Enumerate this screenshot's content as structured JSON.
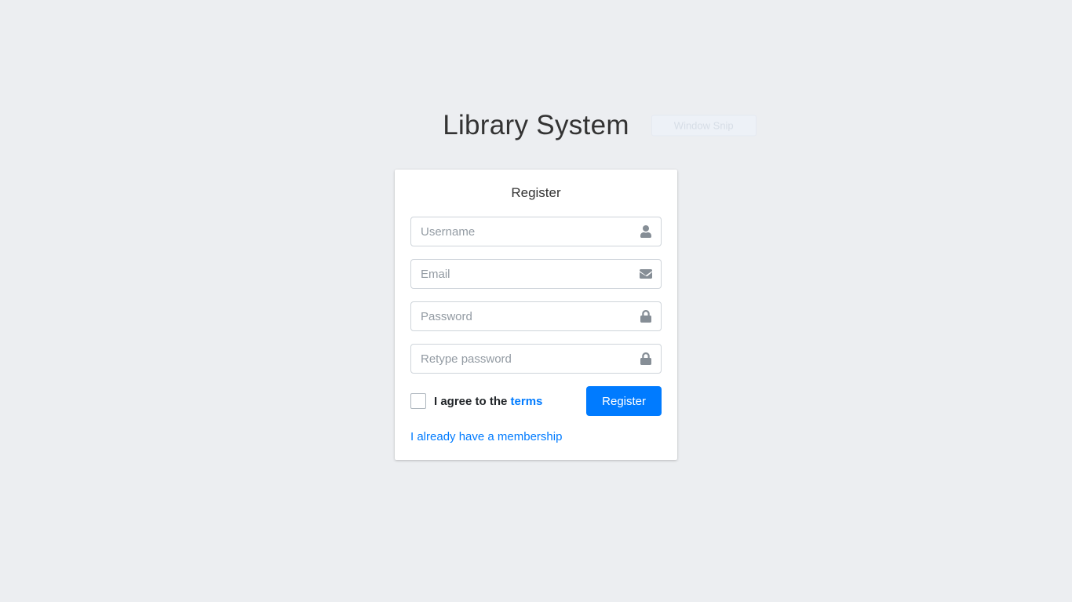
{
  "header": {
    "title": "Library System",
    "snip_label": "Window Snip"
  },
  "card": {
    "title": "Register",
    "username": {
      "placeholder": "Username",
      "value": ""
    },
    "email": {
      "placeholder": "Email",
      "value": ""
    },
    "password": {
      "placeholder": "Password",
      "value": ""
    },
    "retype": {
      "placeholder": "Retype password",
      "value": ""
    },
    "agree_label_prefix": "I agree to the ",
    "terms_label": "terms",
    "submit_label": "Register",
    "alt_link_label": "I already have a membership"
  }
}
